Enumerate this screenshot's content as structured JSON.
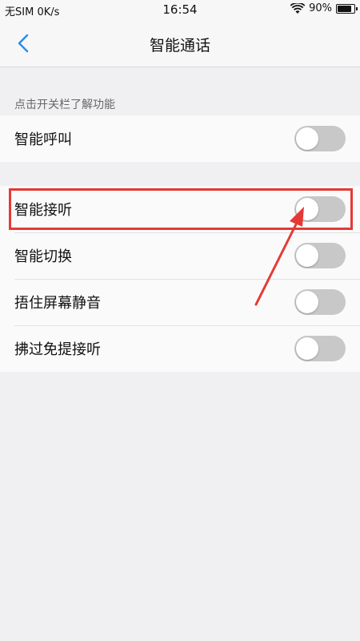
{
  "status_bar": {
    "carrier": "无SIM",
    "speed": "0K/s",
    "time": "16:54",
    "battery": "90%",
    "battery_level": 0.9
  },
  "header": {
    "title": "智能通话",
    "back_icon": "chevron-left-icon"
  },
  "section_header": "点击开关栏了解功能",
  "settings": {
    "group1": [
      {
        "label": "智能呼叫",
        "enabled": false
      }
    ],
    "group2": [
      {
        "label": "智能接听",
        "enabled": false
      },
      {
        "label": "智能切换",
        "enabled": false
      },
      {
        "label": "捂住屏幕静音",
        "enabled": false
      },
      {
        "label": "拂过免提接听",
        "enabled": false
      }
    ]
  },
  "annotation": {
    "color": "#e53935",
    "target": "智能接听"
  },
  "colors": {
    "accent": "#2b8ef0",
    "toggle_off": "#c8c8c8",
    "background": "#f0f0f2"
  }
}
